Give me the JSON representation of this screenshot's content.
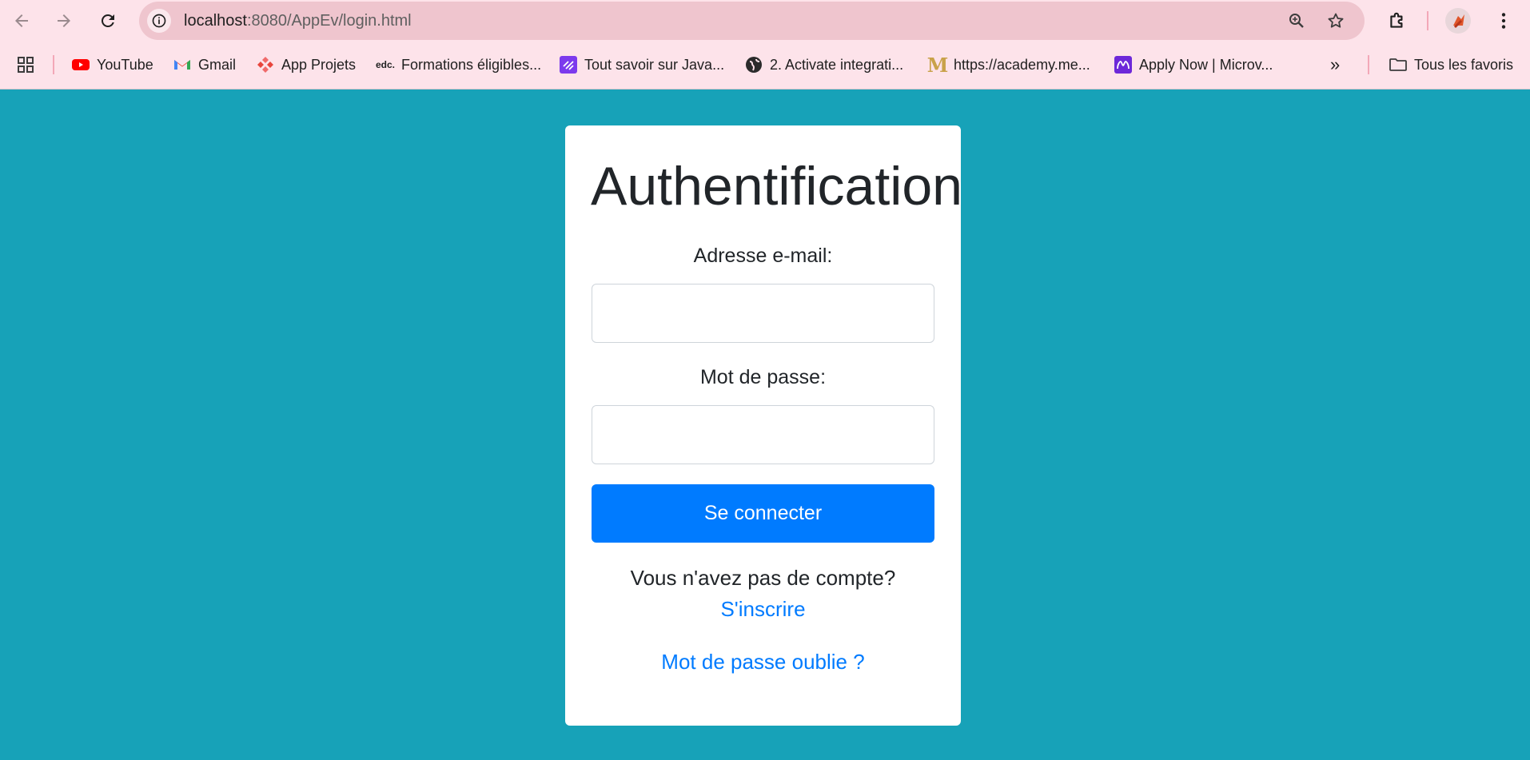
{
  "browser": {
    "url_host": "localhost",
    "url_path": ":8080/AppEv/login.html",
    "bookmarks": [
      {
        "label": "YouTube",
        "icon": "youtube-icon"
      },
      {
        "label": "Gmail",
        "icon": "gmail-icon"
      },
      {
        "label": "App Projets",
        "icon": "app-projets-icon"
      },
      {
        "label": "Formations éligibles...",
        "icon": "edc-icon"
      },
      {
        "label": "Tout savoir sur Java...",
        "icon": "purple-lines-icon"
      },
      {
        "label": "2. Activate integrati...",
        "icon": "globe-icon"
      },
      {
        "label": "https://academy.me...",
        "icon": "academy-m-icon"
      },
      {
        "label": "Apply Now | Microv...",
        "icon": "microverse-icon"
      }
    ],
    "more_bookmarks_label": "»",
    "all_bookmarks_label": "Tous les favoris"
  },
  "colors": {
    "page_background": "#17a2b8",
    "primary": "#007bff",
    "chrome": "#fde3ea"
  },
  "login": {
    "title": "Authentification",
    "email_label": "Adresse e-mail:",
    "email_value": "",
    "password_label": "Mot de passe:",
    "password_value": "",
    "submit_label": "Se connecter",
    "no_account_text": "Vous n'avez pas de compte?",
    "signup_link": "S'inscrire",
    "forgot_link": "Mot de passe oublie ?"
  }
}
